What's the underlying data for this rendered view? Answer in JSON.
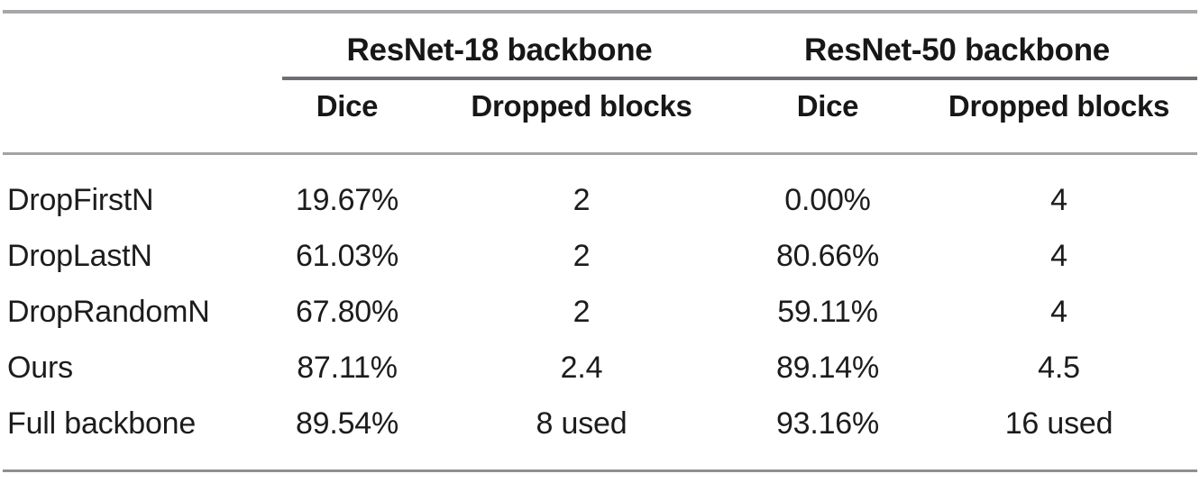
{
  "table": {
    "spanners": [
      {
        "label": "ResNet-18 backbone"
      },
      {
        "label": "ResNet-50 backbone"
      }
    ],
    "columns": [
      {
        "label": ""
      },
      {
        "label": "Dice"
      },
      {
        "label": "Dropped blocks"
      },
      {
        "label": "Dice"
      },
      {
        "label": "Dropped blocks"
      }
    ],
    "rows": [
      {
        "method": "DropFirstN",
        "r18_dice": "19.67%",
        "r18_blocks": "2",
        "r50_dice": "0.00%",
        "r50_blocks": "4"
      },
      {
        "method": "DropLastN",
        "r18_dice": "61.03%",
        "r18_blocks": "2",
        "r50_dice": "80.66%",
        "r50_blocks": "4"
      },
      {
        "method": "DropRandomN",
        "r18_dice": "67.80%",
        "r18_blocks": "2",
        "r50_dice": "59.11%",
        "r50_blocks": "4"
      },
      {
        "method": "Ours",
        "r18_dice": "87.11%",
        "r18_blocks": "2.4",
        "r50_dice": "89.14%",
        "r50_blocks": "4.5"
      },
      {
        "method": "Full backbone",
        "r18_dice": "89.54%",
        "r18_blocks": "8 used",
        "r50_dice": "93.16%",
        "r50_blocks": "16 used"
      }
    ]
  },
  "colors": {
    "rule": "#9a9b9f",
    "text": "#1a1a1a",
    "background": "#ffffff"
  }
}
